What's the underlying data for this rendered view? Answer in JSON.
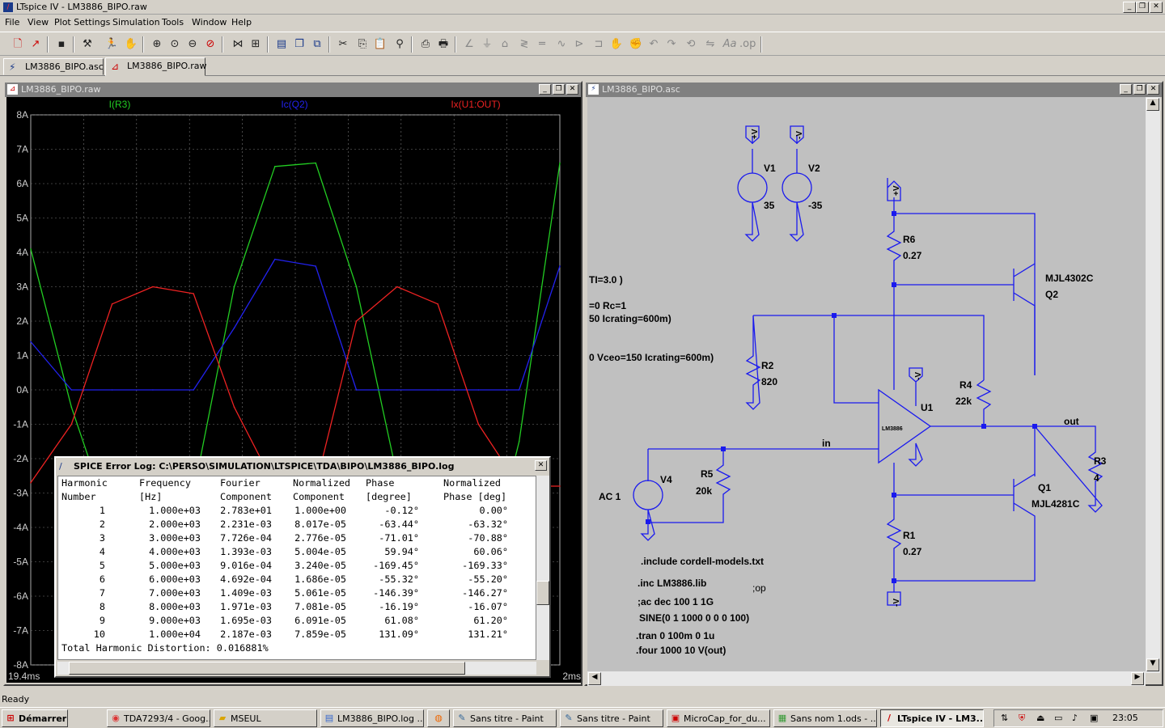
{
  "app": {
    "title": "LTspice IV - LM3886_BIPO.raw",
    "icon_name": "ltspice-logo-icon"
  },
  "menu": {
    "items": [
      "File",
      "View",
      "Plot Settings",
      "Simulation",
      "Tools",
      "Window",
      "Help"
    ]
  },
  "toolbar": {
    "icons": [
      "new-schematic-icon",
      "open-icon",
      "save-icon",
      "control-panel-icon",
      "run-icon",
      "halt-icon",
      "zoom-in-icon",
      "zoom-full-icon",
      "zoom-out-icon",
      "zoom-cancel-icon",
      "autorange-icon",
      "fft-icon",
      "tile-horizontal-icon",
      "tile-vertical-icon",
      "cascade-icon",
      "cut-icon",
      "copy-icon",
      "paste-icon",
      "find-icon",
      "print-setup-icon",
      "print-icon",
      "wire-icon",
      "ground-icon",
      "label-icon",
      "resistor-icon",
      "capacitor-icon",
      "inductor-icon",
      "diode-icon",
      "component-icon",
      "move-icon",
      "drag-icon",
      "undo-icon",
      "redo-icon",
      "rotate-icon",
      "mirror-icon",
      "text-icon",
      "spice-directive-icon"
    ]
  },
  "tabs": [
    {
      "label": "LM3886_BIPO.asc",
      "icon": "schematic-icon"
    },
    {
      "label": "LM3886_BIPO.raw",
      "icon": "waveform-icon"
    }
  ],
  "waveform_window": {
    "title": "LM3886_BIPO.raw",
    "traces": [
      {
        "name": "I(R3)",
        "color": "#22cc22"
      },
      {
        "name": "Ic(Q2)",
        "color": "#2222ee"
      },
      {
        "name": "Ix(U1:OUT)",
        "color": "#ee2222"
      }
    ],
    "x_start_label": "19.4ms",
    "x_end_label": "2ms",
    "bg": "#000000"
  },
  "chart_data": {
    "type": "line",
    "title": "",
    "xlabel": "",
    "ylabel": "",
    "xlim": [
      19.4,
      22.0
    ],
    "ylim": [
      -8,
      8
    ],
    "y_ticks": [
      "8A",
      "7A",
      "6A",
      "5A",
      "4A",
      "3A",
      "2A",
      "1A",
      "0A",
      "-1A",
      "-2A",
      "-3A",
      "-4A",
      "-5A",
      "-6A",
      "-7A",
      "-8A"
    ],
    "x_tick_labels": [
      "19.4ms",
      "2ms"
    ],
    "grid": true,
    "series": [
      {
        "name": "I(R3)",
        "color": "#22cc22",
        "x": [
          19.4,
          19.6,
          19.8,
          20.0,
          20.2,
          20.4,
          20.6,
          20.8,
          21.0,
          21.2,
          21.4,
          21.6,
          21.8,
          22.0
        ],
        "values": [
          4.1,
          -0.5,
          -4.0,
          -6.8,
          -3.0,
          3.0,
          6.5,
          6.6,
          3.0,
          -2.5,
          -6.0,
          -6.3,
          -1.5,
          6.6
        ]
      },
      {
        "name": "Ic(Q2)",
        "color": "#2222ee",
        "x": [
          19.4,
          19.6,
          19.8,
          20.0,
          20.2,
          20.4,
          20.6,
          20.8,
          21.0,
          21.2,
          21.4,
          21.6,
          21.8,
          22.0
        ],
        "values": [
          1.4,
          0,
          0,
          0,
          0,
          1.8,
          3.8,
          3.6,
          0,
          0,
          0,
          0,
          0,
          3.6
        ]
      },
      {
        "name": "Ix(U1:OUT)",
        "color": "#ee2222",
        "x": [
          19.4,
          19.6,
          19.8,
          20.0,
          20.2,
          20.4,
          20.6,
          20.8,
          21.0,
          21.2,
          21.4,
          21.6,
          21.8,
          22.0
        ],
        "values": [
          -2.7,
          -1.0,
          2.5,
          3.0,
          2.8,
          -0.5,
          -2.8,
          -2.8,
          2.0,
          3.0,
          2.5,
          -1.0,
          -2.8,
          -2.8
        ]
      }
    ]
  },
  "schematic_window": {
    "title": "LM3886_BIPO.asc",
    "labels": {
      "v1": "V1",
      "v1_val": "35",
      "v2": "V2",
      "v2_val": "-35",
      "pv1": "+V",
      "nv1": "-V",
      "pv2": "+V",
      "nv2": "-V",
      "nv3": "-V",
      "r6": "R6",
      "r6_val": "0.27",
      "q2": "Q2",
      "q2_model": "MJL4302C",
      "r2": "R2",
      "r2_val": "820",
      "r4": "R4",
      "r4_val": "22k",
      "u1": "U1",
      "u1_part": "LM3886",
      "out": "out",
      "r3": "R3",
      "r3_val": "4",
      "in": "in",
      "r5": "R5",
      "r5_val": "20k",
      "v4": "V4",
      "v4_val": "AC 1",
      "q1": "Q1",
      "q1_model": "MJL4281C",
      "r1": "R1",
      "r1_val": "0.27",
      "frag1": "TI=3.0 )",
      "frag2": "=0 Rc=1",
      "frag3": "50 Icrating=600m)",
      "frag4": "0 Vceo=150 Icrating=600m)",
      "dir1": ".include cordell-models.txt",
      "dir2": ".inc LM3886.lib",
      "dir3": ";op",
      "dir4": ";ac dec 100 1 1G",
      "dir5": "SINE(0 1 1000 0 0 0 100)",
      "dir6": ".tran 0 100m 0 1u",
      "dir7": ".four 1000 10 V(out)"
    },
    "wire_color": "#1a1aee"
  },
  "error_log": {
    "title": "SPICE Error Log: C:\\PERSO\\SIMULATION\\LTSPICE\\TDA\\BIPO\\LM3886_BIPO.log",
    "header1": [
      "Harmonic",
      "Frequency",
      "Fourier",
      "Normalized",
      "Phase",
      "Normalized"
    ],
    "header2": [
      "Number",
      "[Hz]",
      "Component",
      "Component",
      "[degree]",
      "Phase [deg]"
    ],
    "rows": [
      [
        "1",
        "1.000e+03",
        "2.783e+01",
        "1.000e+00",
        "-0.12°",
        "0.00°"
      ],
      [
        "2",
        "2.000e+03",
        "2.231e-03",
        "8.017e-05",
        "-63.44°",
        "-63.32°"
      ],
      [
        "3",
        "3.000e+03",
        "7.726e-04",
        "2.776e-05",
        "-71.01°",
        "-70.88°"
      ],
      [
        "4",
        "4.000e+03",
        "1.393e-03",
        "5.004e-05",
        "59.94°",
        "60.06°"
      ],
      [
        "5",
        "5.000e+03",
        "9.016e-04",
        "3.240e-05",
        "-169.45°",
        "-169.33°"
      ],
      [
        "6",
        "6.000e+03",
        "4.692e-04",
        "1.686e-05",
        "-55.32°",
        "-55.20°"
      ],
      [
        "7",
        "7.000e+03",
        "1.409e-03",
        "5.061e-05",
        "-146.39°",
        "-146.27°"
      ],
      [
        "8",
        "8.000e+03",
        "1.971e-03",
        "7.081e-05",
        "-16.19°",
        "-16.07°"
      ],
      [
        "9",
        "9.000e+03",
        "1.695e-03",
        "6.091e-05",
        "61.08°",
        "61.20°"
      ],
      [
        "10",
        "1.000e+04",
        "2.187e-03",
        "7.859e-05",
        "131.09°",
        "131.21°"
      ]
    ],
    "thd": "Total Harmonic Distortion: 0.016881%"
  },
  "status": {
    "text": "Ready"
  },
  "taskbar": {
    "start": "Démarrer",
    "tasks": [
      {
        "label": "TDA7293/4 - Goog...",
        "icon": "chrome-icon"
      },
      {
        "label": "MSEUL",
        "icon": "folder-icon"
      },
      {
        "label": "LM3886_BIPO.log ...",
        "icon": "notepad-icon"
      },
      {
        "label": "",
        "icon": "firefox-icon"
      },
      {
        "label": "Sans titre - Paint",
        "icon": "paint-icon"
      },
      {
        "label": "Sans titre - Paint",
        "icon": "paint-icon"
      },
      {
        "label": "MicroCap_for_du...",
        "icon": "pdf-icon"
      },
      {
        "label": "Sans nom 1.ods - ...",
        "icon": "calc-icon"
      },
      {
        "label": "LTspice IV - LM3...",
        "icon": "ltspice-icon"
      }
    ],
    "clock": "23:05"
  }
}
